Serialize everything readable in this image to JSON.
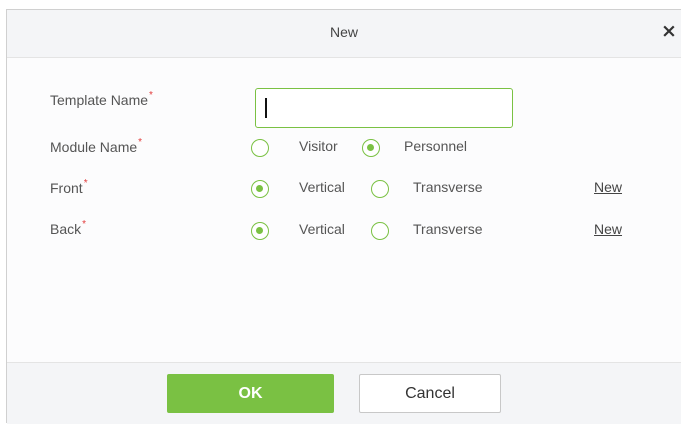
{
  "dialog": {
    "title": "New",
    "close_symbol": "×"
  },
  "form": {
    "template_name": {
      "label": "Template Name",
      "required_mark": "*",
      "value": ""
    },
    "module_name": {
      "label": "Module Name",
      "required_mark": "*",
      "options": [
        {
          "label": "Visitor",
          "checked": false
        },
        {
          "label": "Personnel",
          "checked": true
        }
      ]
    },
    "front": {
      "label": "Front",
      "required_mark": "*",
      "options": [
        {
          "label": "Vertical",
          "checked": true
        },
        {
          "label": "Transverse",
          "checked": false
        }
      ],
      "link": "New"
    },
    "back": {
      "label": "Back",
      "required_mark": "*",
      "options": [
        {
          "label": "Vertical",
          "checked": true
        },
        {
          "label": "Transverse",
          "checked": false
        }
      ],
      "link": "New"
    }
  },
  "footer": {
    "ok_label": "OK",
    "cancel_label": "Cancel"
  },
  "colors": {
    "accent": "#7ac143",
    "required": "#e23b3b"
  }
}
